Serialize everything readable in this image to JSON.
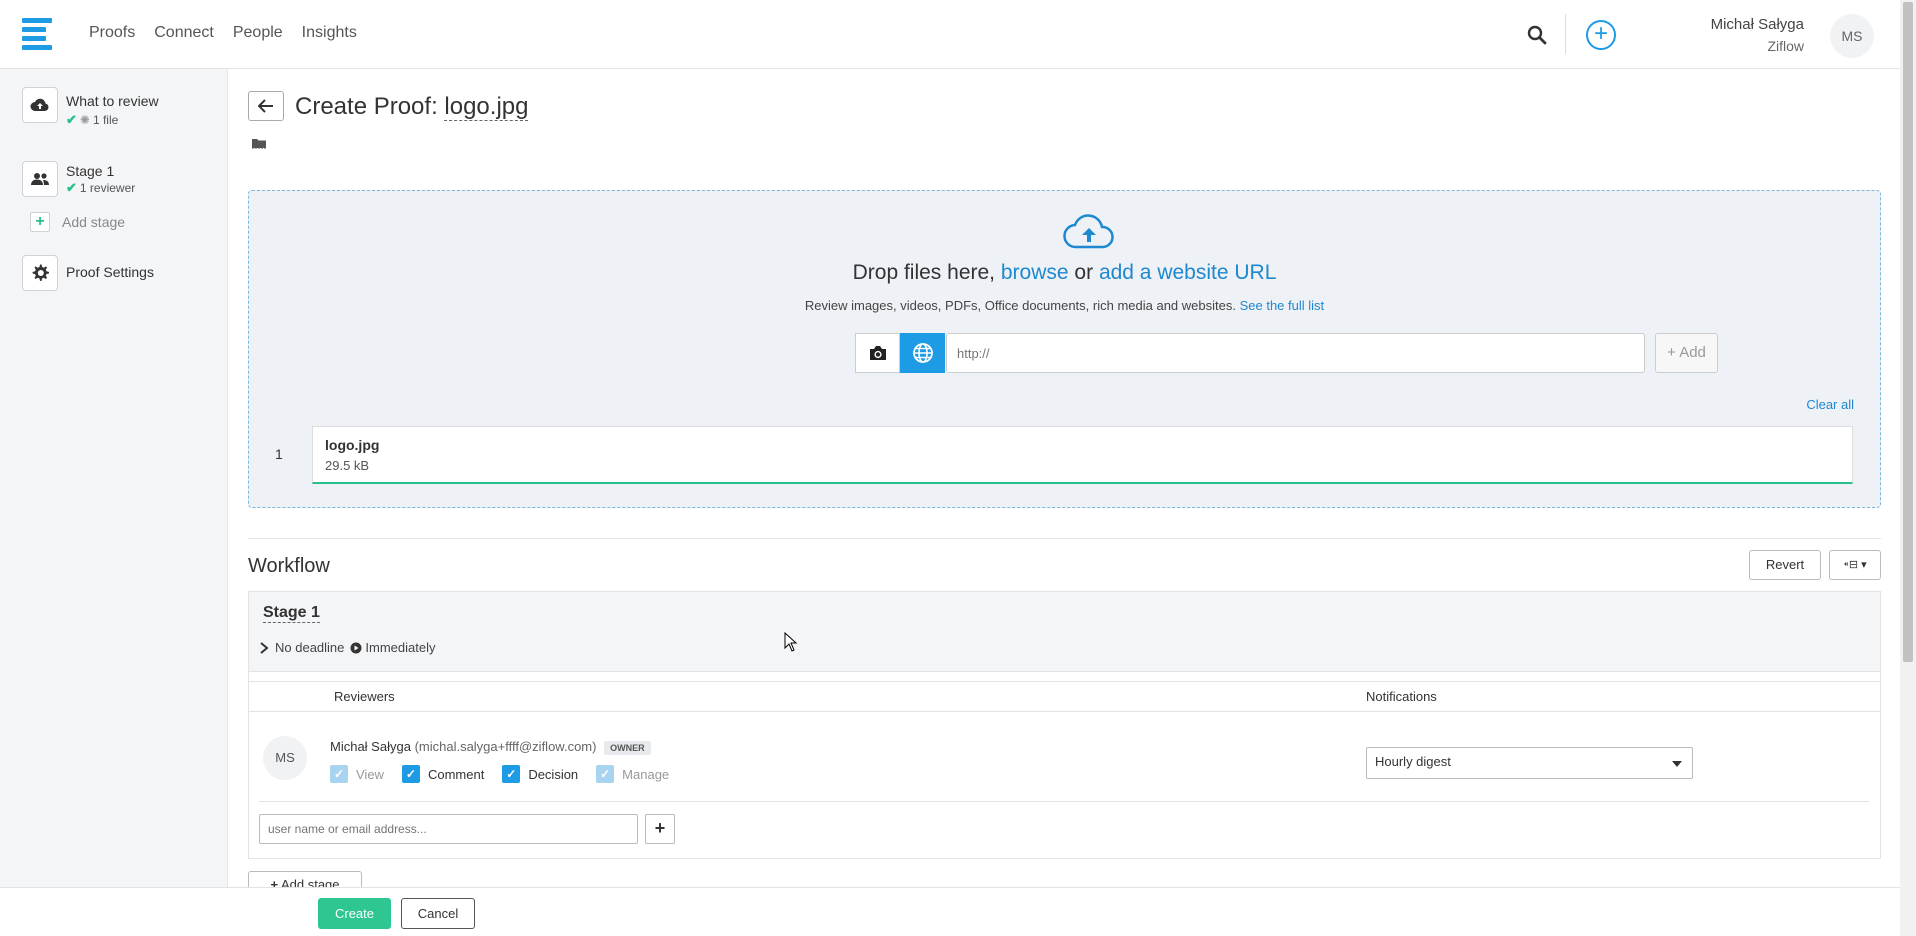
{
  "nav": [
    "Proofs",
    "Connect",
    "People",
    "Insights"
  ],
  "user": {
    "name": "Michał Sałyga",
    "org": "Ziflow",
    "initials": "MS"
  },
  "sidebar": {
    "review": {
      "title": "What to review",
      "sub": "1 file"
    },
    "stage": {
      "title": "Stage 1",
      "sub": "1 reviewer"
    },
    "add_stage": "Add stage",
    "settings": "Proof Settings"
  },
  "header": {
    "prefix": "Create Proof:",
    "filename": "logo.jpg"
  },
  "dropzone": {
    "text_a": "Drop files here,",
    "browse": "browse",
    "or": "or",
    "add_url": "add a website URL",
    "sub": "Review images, videos, PDFs, Office documents, rich media and websites.",
    "full_list": "See the full list",
    "url_placeholder": "http://",
    "add_btn": "+ Add",
    "clear_all": "Clear all"
  },
  "files": [
    {
      "num": "1",
      "name": "logo.jpg",
      "size": "29.5 kB"
    }
  ],
  "workflow": {
    "title": "Workflow",
    "revert": "Revert",
    "stage_name": "Stage 1",
    "deadline": "No deadline",
    "start": "Immediately",
    "col_reviewers": "Reviewers",
    "col_notifications": "Notifications",
    "reviewer": {
      "initials": "MS",
      "name": "Michał Sałyga",
      "email": "(michal.salyga+ffff@ziflow.com)",
      "badge": "OWNER",
      "perms": {
        "view": "View",
        "comment": "Comment",
        "decision": "Decision",
        "manage": "Manage"
      },
      "notification": "Hourly digest"
    },
    "user_placeholder": "user name or email address...",
    "add_stage": "Add stage"
  },
  "footer": {
    "create": "Create",
    "cancel": "Cancel"
  },
  "colors": {
    "accent": "#1e9be5",
    "success": "#2ec691",
    "link": "#1e88d0"
  }
}
